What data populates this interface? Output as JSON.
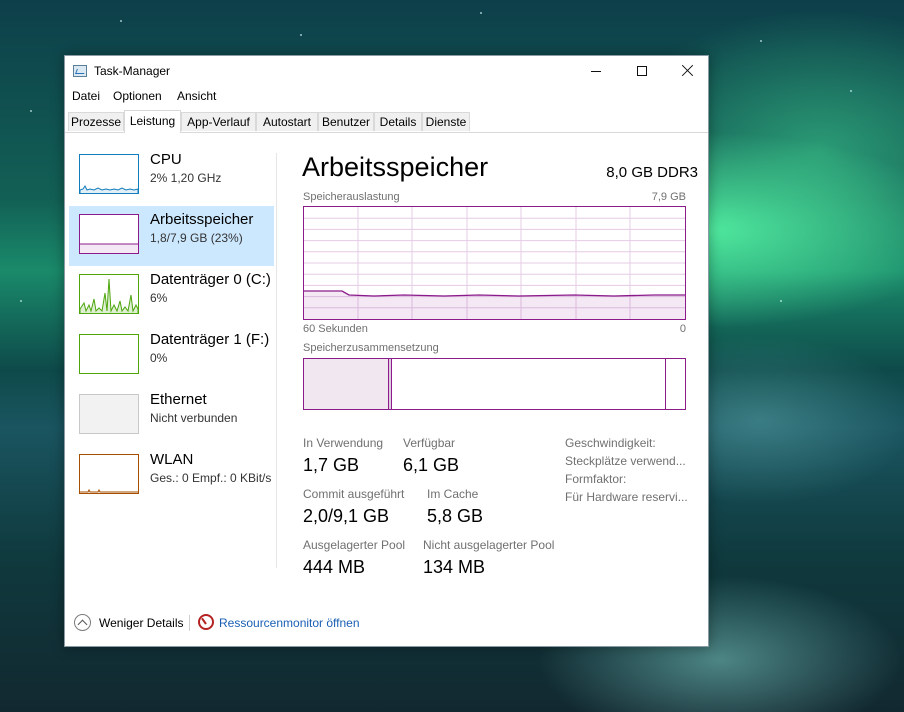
{
  "window": {
    "title": "Task-Manager"
  },
  "menu": [
    "Datei",
    "Optionen",
    "Ansicht"
  ],
  "tabs": [
    {
      "label": "Prozesse"
    },
    {
      "label": "Leistung",
      "active": true
    },
    {
      "label": "App-Verlauf"
    },
    {
      "label": "Autostart"
    },
    {
      "label": "Benutzer"
    },
    {
      "label": "Details"
    },
    {
      "label": "Dienste"
    }
  ],
  "sidebar": [
    {
      "title": "CPU",
      "subtitle": "2% 1,20 GHz",
      "color": "#117dbb"
    },
    {
      "title": "Arbeitsspeicher",
      "subtitle": "1,8/7,9 GB (23%)",
      "color": "#8b1a8b",
      "selected": true
    },
    {
      "title": "Datenträger 0 (C:)",
      "subtitle": "6%",
      "color": "#4da60c"
    },
    {
      "title": "Datenträger 1 (F:)",
      "subtitle": "0%",
      "color": "#4da60c"
    },
    {
      "title": "Ethernet",
      "subtitle": "Nicht verbunden",
      "color": "#a0a0a0"
    },
    {
      "title": "WLAN",
      "subtitle": "Ges.: 0  Empf.: 0 KBit/s",
      "color": "#a74f01"
    }
  ],
  "main": {
    "title": "Arbeitsspeicher",
    "spec": "8,0 GB DDR3",
    "graph_label": "Speicherauslastung",
    "graph_max": "7,9 GB",
    "graph_time_left": "60 Sekunden",
    "graph_time_right": "0",
    "composition_label": "Speicherzusammensetzung",
    "usage_fraction": 0.23,
    "stats": [
      {
        "label": "In Verwendung",
        "value": "1,7 GB"
      },
      {
        "label": "Verfügbar",
        "value": "6,1 GB"
      },
      {
        "label": "Commit ausgeführt",
        "value": "2,0/9,1 GB"
      },
      {
        "label": "Im Cache",
        "value": "5,8 GB"
      },
      {
        "label": "Ausgelagerter Pool",
        "value": "444 MB"
      },
      {
        "label": "Nicht ausgelagerter Pool",
        "value": "134 MB"
      }
    ],
    "details": [
      "Geschwindigkeit:",
      "Steckplätze verwend...",
      "Formfaktor:",
      "Für Hardware reservi..."
    ]
  },
  "footer": {
    "less_details": "Weniger Details",
    "resource_monitor": "Ressourcenmonitor öffnen"
  }
}
